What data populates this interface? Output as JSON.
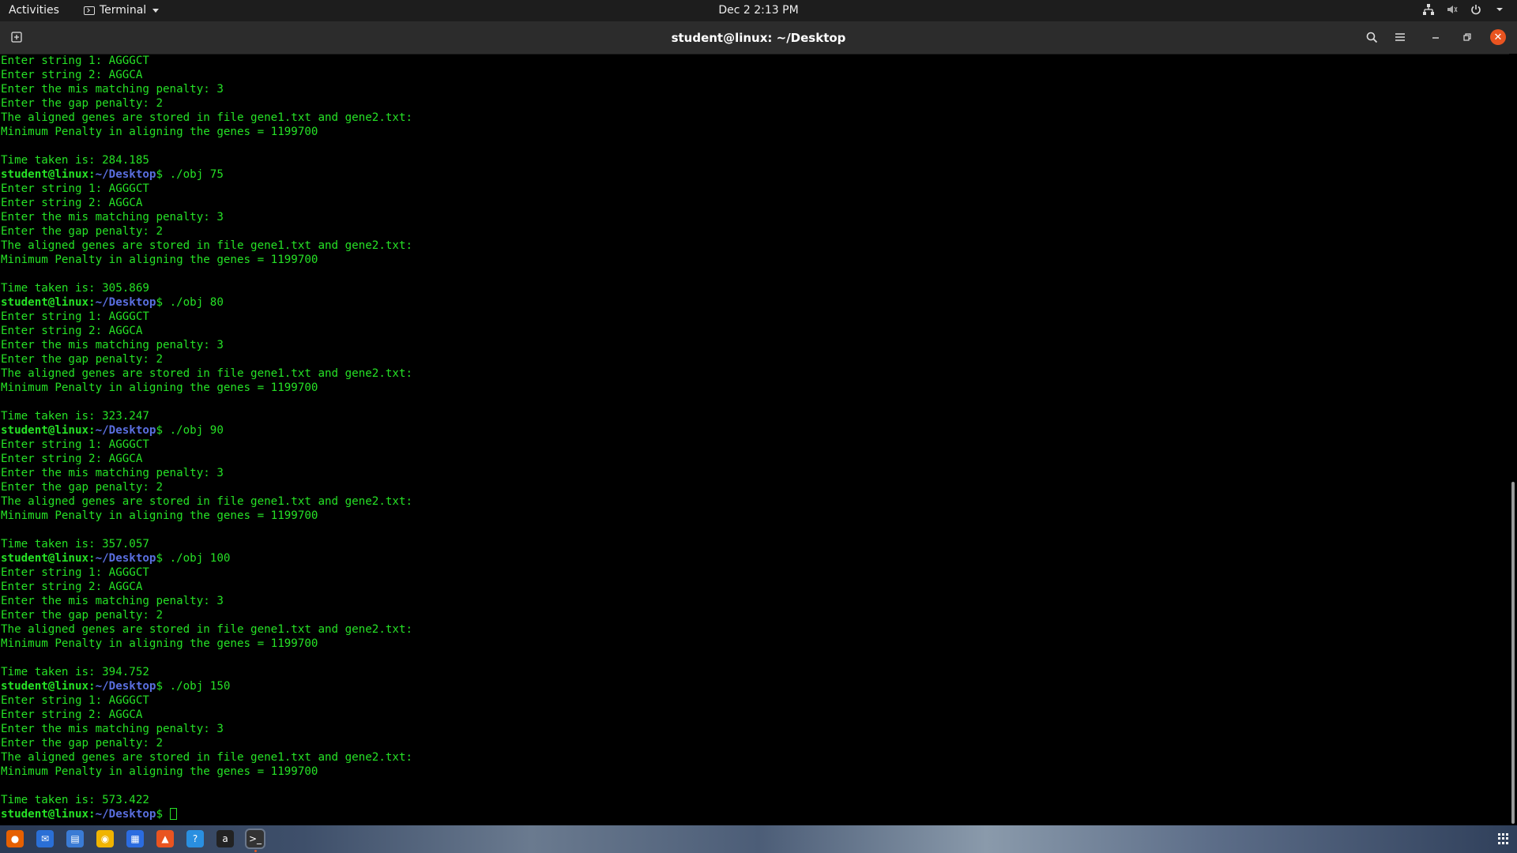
{
  "topbar": {
    "activities": "Activities",
    "app_name": "Terminal",
    "clock": "Dec 2  2:13 PM",
    "tray_icons": [
      "network-icon",
      "volume-icon",
      "power-icon",
      "chevron-down-icon"
    ]
  },
  "window": {
    "title": "student@linux: ~/Desktop"
  },
  "terminal": {
    "prompt_user": "student@linux",
    "prompt_sep": ":",
    "prompt_path": "~/Desktop",
    "prompt_symbol": "$ ",
    "lines": [
      {
        "text": "Enter string 1: AGGGCT"
      },
      {
        "text": "Enter string 2: AGGCA"
      },
      {
        "text": "Enter the mis matching penalty: 3"
      },
      {
        "text": "Enter the gap penalty: 2"
      },
      {
        "text": "The aligned genes are stored in file gene1.txt and gene2.txt:"
      },
      {
        "text": "Minimum Penalty in aligning the genes = 1199700"
      },
      {
        "text": ""
      },
      {
        "text": "Time taken is: 284.185"
      },
      {
        "prompt": true,
        "text": "./obj 75"
      },
      {
        "text": "Enter string 1: AGGGCT"
      },
      {
        "text": "Enter string 2: AGGCA"
      },
      {
        "text": "Enter the mis matching penalty: 3"
      },
      {
        "text": "Enter the gap penalty: 2"
      },
      {
        "text": "The aligned genes are stored in file gene1.txt and gene2.txt:"
      },
      {
        "text": "Minimum Penalty in aligning the genes = 1199700"
      },
      {
        "text": ""
      },
      {
        "text": "Time taken is: 305.869"
      },
      {
        "prompt": true,
        "text": "./obj 80"
      },
      {
        "text": "Enter string 1: AGGGCT"
      },
      {
        "text": "Enter string 2: AGGCA"
      },
      {
        "text": "Enter the mis matching penalty: 3"
      },
      {
        "text": "Enter the gap penalty: 2"
      },
      {
        "text": "The aligned genes are stored in file gene1.txt and gene2.txt:"
      },
      {
        "text": "Minimum Penalty in aligning the genes = 1199700"
      },
      {
        "text": ""
      },
      {
        "text": "Time taken is: 323.247"
      },
      {
        "prompt": true,
        "text": "./obj 90"
      },
      {
        "text": "Enter string 1: AGGGCT"
      },
      {
        "text": "Enter string 2: AGGCA"
      },
      {
        "text": "Enter the mis matching penalty: 3"
      },
      {
        "text": "Enter the gap penalty: 2"
      },
      {
        "text": "The aligned genes are stored in file gene1.txt and gene2.txt:"
      },
      {
        "text": "Minimum Penalty in aligning the genes = 1199700"
      },
      {
        "text": ""
      },
      {
        "text": "Time taken is: 357.057"
      },
      {
        "prompt": true,
        "text": "./obj 100"
      },
      {
        "text": "Enter string 1: AGGGCT"
      },
      {
        "text": "Enter string 2: AGGCA"
      },
      {
        "text": "Enter the mis matching penalty: 3"
      },
      {
        "text": "Enter the gap penalty: 2"
      },
      {
        "text": "The aligned genes are stored in file gene1.txt and gene2.txt:"
      },
      {
        "text": "Minimum Penalty in aligning the genes = 1199700"
      },
      {
        "text": ""
      },
      {
        "text": "Time taken is: 394.752"
      },
      {
        "prompt": true,
        "text": "./obj 150"
      },
      {
        "text": "Enter string 1: AGGGCT"
      },
      {
        "text": "Enter string 2: AGGCA"
      },
      {
        "text": "Enter the mis matching penalty: 3"
      },
      {
        "text": "Enter the gap penalty: 2"
      },
      {
        "text": "The aligned genes are stored in file gene1.txt and gene2.txt:"
      },
      {
        "text": "Minimum Penalty in aligning the genes = 1199700"
      },
      {
        "text": ""
      },
      {
        "text": "Time taken is: 573.422"
      },
      {
        "prompt": true,
        "text": "",
        "cursor": true
      }
    ]
  },
  "dock": {
    "items": [
      {
        "name": "firefox-icon",
        "color": "#e66000"
      },
      {
        "name": "thunderbird-icon",
        "color": "#2a6fd6"
      },
      {
        "name": "text-document-icon",
        "color": "#3a7bd5"
      },
      {
        "name": "rhythmbox-icon",
        "color": "#f0b400"
      },
      {
        "name": "writer-icon",
        "color": "#2b6ce0"
      },
      {
        "name": "software-center-icon",
        "color": "#e95420"
      },
      {
        "name": "help-icon",
        "color": "#2a8fe0"
      },
      {
        "name": "amazon-icon",
        "color": "#222222"
      },
      {
        "name": "terminal-icon",
        "color": "#333333",
        "active": true
      }
    ]
  },
  "colors": {
    "terminal_fg": "#26e126",
    "prompt_path": "#5a6fe0",
    "close_button": "#e95420"
  }
}
